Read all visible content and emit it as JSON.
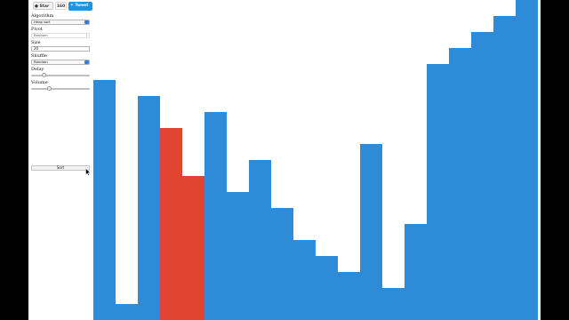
{
  "github": {
    "star_label": "Star",
    "star_count": "160",
    "tweet_label": "Tweet"
  },
  "controls": {
    "algorithm": {
      "label": "Algorithm",
      "value": "Heap sort"
    },
    "pivot": {
      "label": "Pivot",
      "value": "Random"
    },
    "size": {
      "label": "Size",
      "value": "20"
    },
    "shuffle": {
      "label": "Shuffle",
      "value": "Random"
    },
    "delay": {
      "label": "Delay",
      "level": 0.2
    },
    "volume": {
      "label": "Volume",
      "level": 0.3
    },
    "sort_label": "Sort"
  },
  "colors": {
    "bar": "#2e8bd8",
    "highlight": "#e24432"
  },
  "chart_data": {
    "type": "bar",
    "max_value": 20,
    "values": [
      15,
      1,
      14,
      12,
      9,
      13,
      8,
      10,
      7,
      5,
      4,
      3,
      11,
      2,
      6,
      16,
      17,
      18,
      19,
      20
    ],
    "highlighted": [
      3,
      4
    ]
  }
}
